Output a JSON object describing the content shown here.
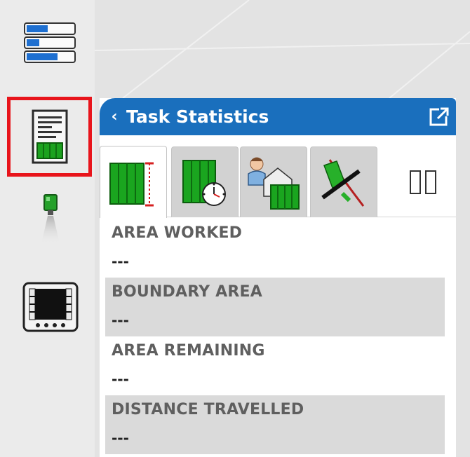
{
  "toolbar": {
    "items": [
      {
        "id": "overview",
        "icon": "bar-list-icon"
      },
      {
        "id": "task-statistics",
        "icon": "statistics-document-icon",
        "selected": true
      },
      {
        "id": "gps",
        "icon": "gps-receiver-icon"
      },
      {
        "id": "screen",
        "icon": "monitor-icon"
      }
    ]
  },
  "panel": {
    "title": "Task Statistics",
    "back_glyph": "‹",
    "tabs": [
      {
        "id": "area",
        "icon": "area-worked-icon",
        "active": true
      },
      {
        "id": "time",
        "icon": "field-clock-icon",
        "active": false
      },
      {
        "id": "client-farm",
        "icon": "farmer-barn-field-icon",
        "active": false
      },
      {
        "id": "guidance",
        "icon": "guidance-line-icon",
        "active": false
      }
    ],
    "more_glyph": "▯▯",
    "stats": [
      {
        "label": "AREA WORKED",
        "value": "---"
      },
      {
        "label": "BOUNDARY AREA",
        "value": "---"
      },
      {
        "label": "AREA REMAINING",
        "value": "---"
      },
      {
        "label": "DISTANCE TRAVELLED",
        "value": "---"
      }
    ]
  },
  "colors": {
    "header_blue": "#1a6fbd",
    "selected_border": "#e8141b",
    "field_green": "#1aa51f",
    "row_shade": "#dadada"
  }
}
